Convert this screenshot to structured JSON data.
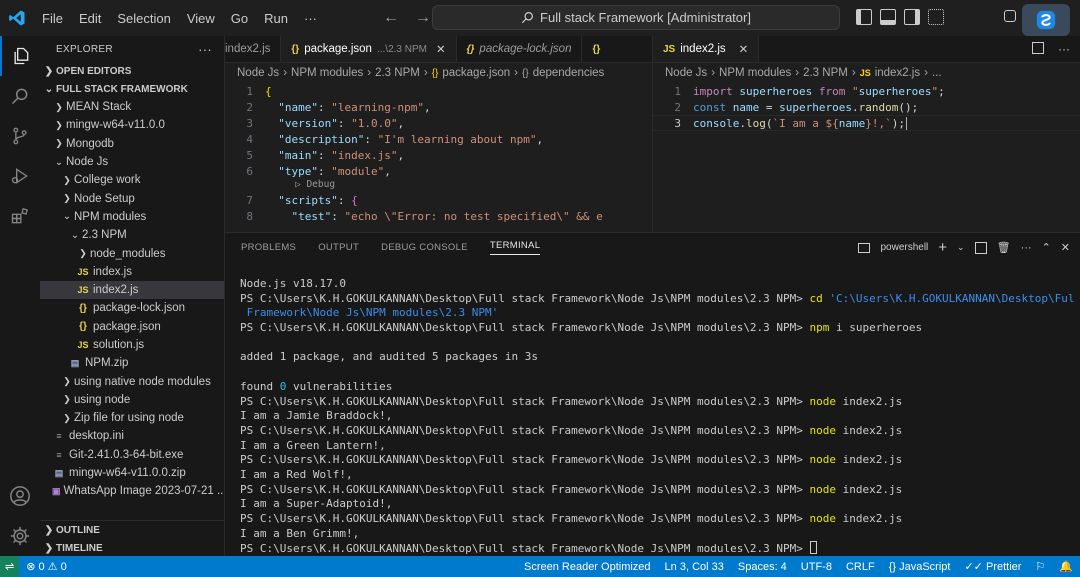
{
  "titlebar": {
    "menu": [
      "File",
      "Edit",
      "Selection",
      "View",
      "Go",
      "Run",
      "···"
    ],
    "title": "Full stack Framework [Administrator]"
  },
  "sidebar": {
    "header": "EXPLORER",
    "open_editors": "OPEN EDITORS",
    "root": "FULL STACK FRAMEWORK",
    "items": [
      {
        "label": "MEAN Stack",
        "depth": 1,
        "kind": "folder"
      },
      {
        "label": "mingw-w64-v11.0.0",
        "depth": 1,
        "kind": "folder"
      },
      {
        "label": "Mongodb",
        "depth": 1,
        "kind": "folder"
      },
      {
        "label": "Node Js",
        "depth": 1,
        "kind": "folder-open"
      },
      {
        "label": "College work",
        "depth": 2,
        "kind": "folder"
      },
      {
        "label": "Node Setup",
        "depth": 2,
        "kind": "folder"
      },
      {
        "label": "NPM modules",
        "depth": 2,
        "kind": "folder-open"
      },
      {
        "label": "2.3 NPM",
        "depth": 3,
        "kind": "folder-open"
      },
      {
        "label": "node_modules",
        "depth": 4,
        "kind": "folder"
      },
      {
        "label": "index.js",
        "depth": 4,
        "kind": "js"
      },
      {
        "label": "index2.js",
        "depth": 4,
        "kind": "js",
        "selected": true
      },
      {
        "label": "package-lock.json",
        "depth": 4,
        "kind": "json"
      },
      {
        "label": "package.json",
        "depth": 4,
        "kind": "json"
      },
      {
        "label": "solution.js",
        "depth": 4,
        "kind": "js"
      },
      {
        "label": "NPM.zip",
        "depth": 3,
        "kind": "zip"
      },
      {
        "label": "using native node modules",
        "depth": 2,
        "kind": "folder"
      },
      {
        "label": "using node",
        "depth": 2,
        "kind": "folder"
      },
      {
        "label": "Zip file for using node",
        "depth": 2,
        "kind": "folder"
      },
      {
        "label": "desktop.ini",
        "depth": 1,
        "kind": "file"
      },
      {
        "label": "Git-2.41.0.3-64-bit.exe",
        "depth": 1,
        "kind": "file"
      },
      {
        "label": "mingw-w64-v11.0.0.zip",
        "depth": 1,
        "kind": "zip"
      },
      {
        "label": "WhatsApp Image 2023-07-21 ...",
        "depth": 1,
        "kind": "img"
      }
    ],
    "outline": "OUTLINE",
    "timeline": "TIMELINE"
  },
  "editor_left": {
    "tabs": [
      {
        "label": "index2.js",
        "desc": "",
        "icon": "JS",
        "active": false
      },
      {
        "label": "package.json",
        "desc": "...\\2.3 NPM",
        "icon": "{}",
        "active": true
      },
      {
        "label": "package-lock.json",
        "desc": "",
        "icon": "{}",
        "active": false
      }
    ],
    "breadcrumb": [
      "Node Js",
      "NPM modules",
      "2.3 NPM",
      "package.json",
      "dependencies"
    ],
    "lines": [
      {
        "n": "1",
        "text": "{"
      },
      {
        "n": "2",
        "text": "  \"name\": \"learning-npm\","
      },
      {
        "n": "3",
        "text": "  \"version\": \"1.0.0\","
      },
      {
        "n": "4",
        "text": "  \"description\": \"I'm learning about npm\","
      },
      {
        "n": "5",
        "text": "  \"main\": \"index.js\","
      },
      {
        "n": "6",
        "text": "  \"type\": \"module\","
      },
      {
        "n": "7",
        "text": "  \"scripts\": {"
      },
      {
        "n": "8",
        "text": "    \"test\": \"echo \\\"Error: no test specified\\\" && e"
      }
    ],
    "codelens": "▷ Debug"
  },
  "editor_right": {
    "tab": {
      "label": "index2.js",
      "icon": "JS"
    },
    "breadcrumb": [
      "Node Js",
      "NPM modules",
      "2.3 NPM",
      "index2.js",
      "..."
    ],
    "lines": [
      {
        "n": "1",
        "text": "import superheroes from \"superheroes\";"
      },
      {
        "n": "2",
        "text": "const name = superheroes.random();"
      },
      {
        "n": "3",
        "text": "console.log(`I am a ${name}!,`);"
      }
    ]
  },
  "panel": {
    "tabs": [
      "PROBLEMS",
      "OUTPUT",
      "DEBUG CONSOLE",
      "TERMINAL"
    ],
    "active_tab": "TERMINAL",
    "shell": "powershell",
    "terminal": {
      "node_version": "Node.js v18.17.0",
      "prompt": "PS C:\\Users\\K.H.GOKULKANNAN\\Desktop\\Full stack Framework\\Node Js\\NPM modules\\2.3 NPM>",
      "cd_cmd": "cd",
      "cd_arg_1": "'C:\\Users\\K.H.GOKULKANNAN\\Desktop\\Full stack",
      "cd_arg_2": " Framework\\Node Js\\NPM modules\\2.3 NPM'",
      "npm_cmd": "npm",
      "npm_args": " i superheroes",
      "added": "added 1 package, and audited 5 packages in 3s",
      "found_pre": "found ",
      "found_num": "0",
      "found_post": " vulnerabilities",
      "node_cmd": "node",
      "node_args": " index2.js",
      "outputs": [
        "I am a Jamie Braddock!,",
        "I am a Green Lantern!,",
        "I am a Red Wolf!,",
        "I am a Super-Adaptoid!,",
        "I am a Ben Grimm!,"
      ]
    }
  },
  "statusbar": {
    "problems": "⊗ 0 ⚠ 0",
    "screen_reader": "Screen Reader Optimized",
    "position": "Ln 3, Col 33",
    "spaces": "Spaces: 4",
    "encoding": "UTF-8",
    "eol": "CRLF",
    "language": "{} JavaScript",
    "prettier": "✓✓ Prettier"
  },
  "colors": {
    "statusbar": "#007acc",
    "accent": "#0078d4"
  }
}
